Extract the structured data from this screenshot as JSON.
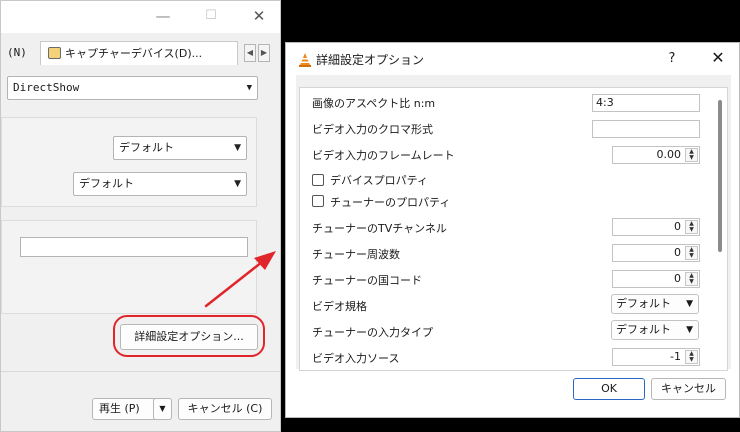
{
  "back_window": {
    "minimize_glyph": "—",
    "maximize_glyph": "☐",
    "close_glyph": "✕",
    "tabs": {
      "network_label": "(N)",
      "capture_label": "キャプチャーデバイス(D)...",
      "prev_arrow": "◀",
      "next_arrow": "▶"
    },
    "device_type_value": "DirectShow",
    "video_device_value": "デフォルト",
    "audio_device_value": "デフォルト",
    "advanced_button_label": "詳細設定オプション...",
    "play_button_label": "再生 (P)",
    "play_dropdown_glyph": "▼",
    "cancel_button_label": "キャンセル (C)"
  },
  "dialog": {
    "title": "詳細設定オプション",
    "help_glyph": "?",
    "close_glyph": "✕",
    "rows": {
      "aspect_ratio_label": "画像のアスペクト比 n:m",
      "aspect_ratio_value": "4:3",
      "chroma_label": "ビデオ入力のクロマ形式",
      "chroma_value": "",
      "frame_rate_label": "ビデオ入力のフレームレート",
      "frame_rate_value": "0.00",
      "device_props_label": "デバイスプロパティ",
      "tuner_props_label": "チューナーのプロパティ",
      "tv_channel_label": "チューナーのTVチャンネル",
      "tv_channel_value": "0",
      "frequency_label": "チューナー周波数",
      "frequency_value": "0",
      "country_label": "チューナーの国コード",
      "country_value": "0",
      "video_standard_label": "ビデオ規格",
      "video_standard_value": "デフォルト",
      "tuner_input_label": "チューナーの入力タイプ",
      "tuner_input_value": "デフォルト",
      "video_source_label": "ビデオ入力ソース",
      "video_source_value": "-1"
    },
    "ok_label": "OK",
    "cancel_label": "キャンセル"
  },
  "colors": {
    "annotation_red": "#e0262b",
    "default_button_border": "#2b67c6",
    "vlc_orange": "#f08a1c"
  },
  "icons": {
    "app_icon": "vlc-cone-icon",
    "capture_tab_icon": "capture-device-icon"
  }
}
